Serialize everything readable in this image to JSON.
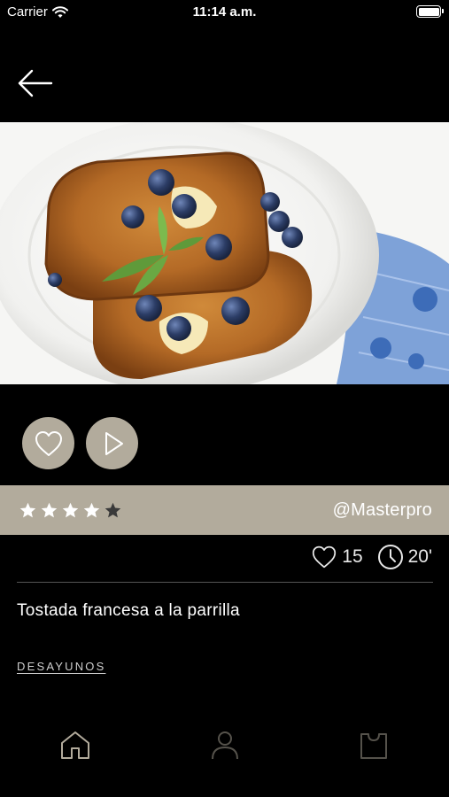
{
  "status_bar": {
    "carrier": "Carrier",
    "time": "11:14 a.m."
  },
  "recipe": {
    "title": "Tostada francesa a la parrilla",
    "author": "@Masterpro",
    "rating": 4,
    "rating_max": 5,
    "likes": "15",
    "time": "20'",
    "category": "DESAYUNOS",
    "image_description": "French toast with blueberries, butter and mint on a white plate"
  },
  "icons": {
    "back": "arrow-left-icon",
    "favorite": "heart-icon",
    "play": "play-icon",
    "likes": "heart-icon",
    "time": "clock-icon",
    "tabs": [
      "home-icon",
      "user-icon",
      "shopping-bag-icon"
    ]
  },
  "colors": {
    "accent": "#b2ab9c",
    "background": "#000000",
    "star_filled": "#ffffff",
    "star_empty": "#3a3a3a"
  }
}
